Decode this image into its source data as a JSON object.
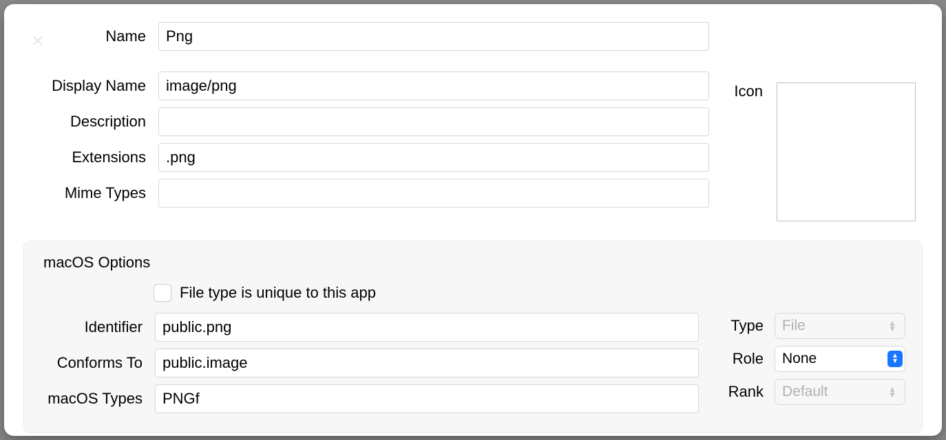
{
  "labels": {
    "name": "Name",
    "display_name": "Display Name",
    "description": "Description",
    "extensions": "Extensions",
    "mime_types": "Mime Types",
    "icon": "Icon"
  },
  "values": {
    "name": "Png",
    "display_name": "image/png",
    "description": "",
    "extensions": ".png",
    "mime_types": ""
  },
  "macos": {
    "title": "macOS Options",
    "checkbox_label": "File type is unique to this app",
    "checkbox_checked": false,
    "labels": {
      "identifier": "Identifier",
      "conforms_to": "Conforms To",
      "macos_types": "macOS Types",
      "type": "Type",
      "role": "Role",
      "rank": "Rank"
    },
    "values": {
      "identifier": "public.png",
      "conforms_to": "public.image",
      "macos_types": "PNGf",
      "type": "File",
      "role": "None",
      "rank": "Default"
    }
  }
}
